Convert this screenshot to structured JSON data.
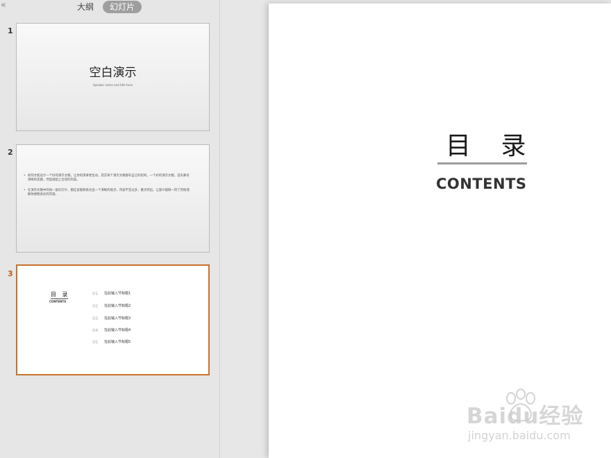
{
  "panel": {
    "collapse_icon": "«",
    "tabs": [
      {
        "label": "大纲",
        "selected": false
      },
      {
        "label": "幻灯片",
        "selected": true
      }
    ]
  },
  "thumbnails": [
    {
      "number": "1",
      "title": "空白演示",
      "subtitle": "Speaker name and title here"
    },
    {
      "number": "2",
      "bullets": [
        "如何才能设计一个好的演示文稿，让你的演讲更生动，其实每个演示文稿都有自己的结构，一个好的演示文稿，首先要有清晰的思路，然后再配上合适的内容。",
        "在演示文稿中的每一张幻灯片，都应该能够表达出一个清晰的观点，内容不宜过多，重点突出，让观众能够一目了然地理解你想要表达的内容。"
      ]
    },
    {
      "number": "3",
      "title": "目 录",
      "subtitle": "CONTENTS",
      "items": [
        {
          "num": "01",
          "text": "在此输入节标题1"
        },
        {
          "num": "02",
          "text": "在此输入节标题2"
        },
        {
          "num": "03",
          "text": "在此输入节标题3"
        },
        {
          "num": "04",
          "text": "在此输入节标题4"
        },
        {
          "num": "05",
          "text": "在此输入节标题5"
        }
      ]
    }
  ],
  "main_slide": {
    "title": "目 录",
    "subtitle": "CONTENTS"
  },
  "watermark": {
    "logo_text": "Baidu经验",
    "url": "jingyan.baidu.com",
    "icon": "paw-icon"
  },
  "colors": {
    "active_border": "#c5712c",
    "active_number": "#c55a11",
    "tab_selected_bg": "#9e9e9e"
  }
}
